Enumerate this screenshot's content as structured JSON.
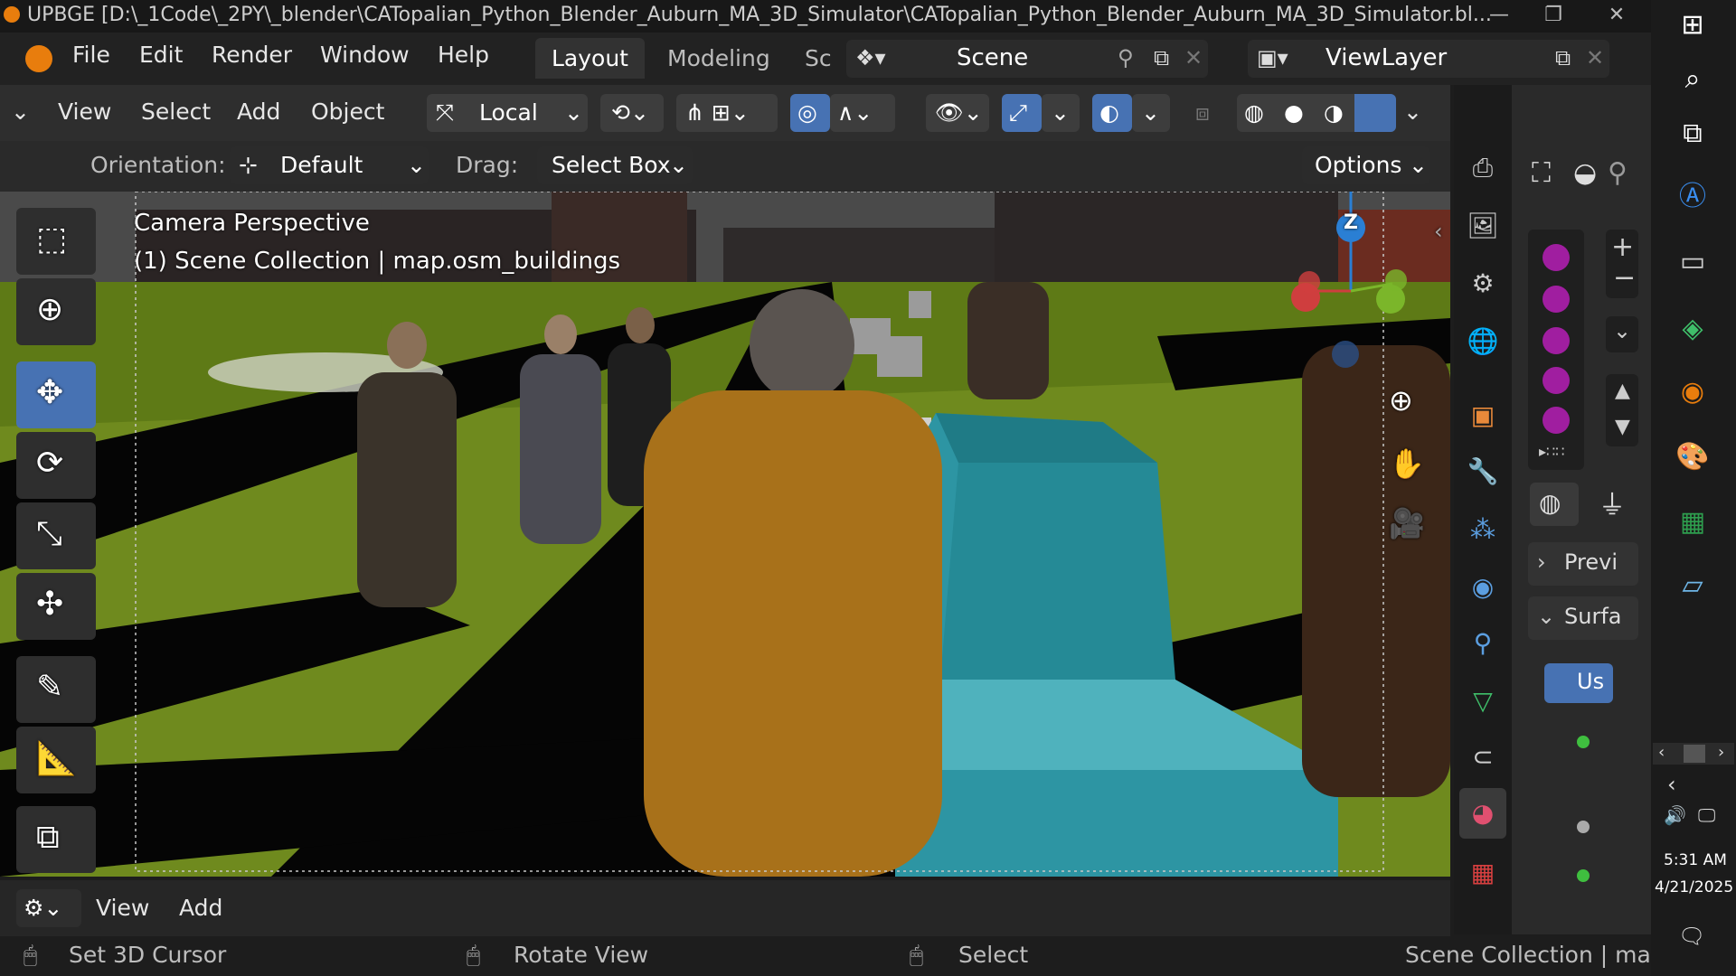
{
  "window": {
    "title": "UPBGE [D:\\_1Code\\_2PY\\_blender\\CATopalian_Python_Blender_Auburn_MA_3D_Simulator\\CATopalian_Python_Blender_Auburn_MA_3D_Simulator.bl...",
    "minimize": "—",
    "maximize": "❐",
    "close": "✕"
  },
  "menubar": {
    "file": "File",
    "edit": "Edit",
    "render": "Render",
    "window": "Window",
    "help": "Help",
    "tabs": [
      "Layout",
      "Modeling",
      "Sc"
    ],
    "scene": "Scene",
    "view_layer": "ViewLayer"
  },
  "header": {
    "view": "View",
    "select": "Select",
    "add": "Add",
    "object": "Object",
    "transform_orientation": "Local"
  },
  "tool_settings": {
    "orientation_label": "Orientation:",
    "orientation_value": "Default",
    "drag_label": "Drag:",
    "drag_value": "Select Box",
    "options": "Options"
  },
  "viewport": {
    "camera_label": "Camera Perspective",
    "collection_label": "(1) Scene Collection | map.osm_buildings",
    "gizmo_z": "Z"
  },
  "properties": {
    "preview": "Previ",
    "surface": "Surfa",
    "use_nodes": "Us"
  },
  "bottom_header": {
    "view": "View",
    "add": "Add"
  },
  "status": {
    "set_cursor": "Set 3D Cursor",
    "rotate_view": "Rotate View",
    "select": "Select",
    "collection": "Scene Collection | map"
  },
  "taskbar": {
    "time": "5:31 AM",
    "date": "4/21/2025"
  },
  "colors": {
    "accent": "#4772b3",
    "grass": "#6f8a1e",
    "road": "#050505",
    "car": "#2d95a3",
    "material_slot": "#a01ea0"
  }
}
